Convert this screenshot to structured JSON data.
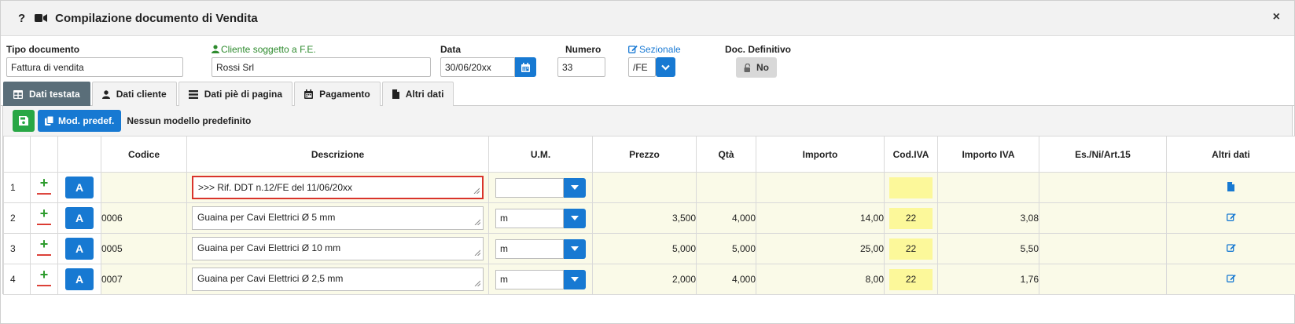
{
  "window": {
    "title": "Compilazione documento di Vendita",
    "help": "?",
    "close": "×"
  },
  "fields": {
    "tipo_label": "Tipo documento",
    "tipo_value": "Fattura di vendita",
    "cliente_label": "Cliente soggetto a F.E.",
    "cliente_value": "Rossi Srl",
    "data_label": "Data",
    "data_value": "30/06/20xx",
    "numero_label": "Numero",
    "numero_value": "33",
    "sezionale_label": "Sezionale",
    "sezionale_value": "/FE",
    "definitivo_label": "Doc. Definitivo",
    "definitivo_value": "No"
  },
  "tabs": [
    {
      "label": "Dati testata",
      "icon": "table-icon",
      "active": true
    },
    {
      "label": "Dati cliente",
      "icon": "user-icon"
    },
    {
      "label": "Dati piè di pagina",
      "icon": "list-icon"
    },
    {
      "label": "Pagamento",
      "icon": "calendar-icon"
    },
    {
      "label": "Altri dati",
      "icon": "file-icon"
    }
  ],
  "toolbar": {
    "mod_label": "Mod. predef.",
    "no_model_text": "Nessun modello predefinito"
  },
  "table": {
    "headers": [
      "Codice",
      "Descrizione",
      "U.M.",
      "Prezzo",
      "Qtà",
      "Importo",
      "Cod.IVA",
      "Importo IVA",
      "Es./Ni/Art.15",
      "Altri dati"
    ],
    "rows": [
      {
        "n": "1",
        "a": "A",
        "codice": "",
        "descrizione": ">>> Rif. DDT n.12/FE del 11/06/20xx",
        "um": "",
        "prezzo": "",
        "qta": "",
        "importo": "",
        "iva": "",
        "importo_iva": "",
        "es": ""
      },
      {
        "n": "2",
        "a": "A",
        "codice": "0006",
        "descrizione": "Guaina per Cavi Elettrici Ø 5 mm",
        "um": "m",
        "prezzo": "3,500",
        "qta": "4,000",
        "importo": "14,00",
        "iva": "22",
        "importo_iva": "3,08",
        "es": ""
      },
      {
        "n": "3",
        "a": "A",
        "codice": "0005",
        "descrizione": "Guaina per Cavi Elettrici Ø 10 mm",
        "um": "m",
        "prezzo": "5,000",
        "qta": "5,000",
        "importo": "25,00",
        "iva": "22",
        "importo_iva": "5,50",
        "es": ""
      },
      {
        "n": "4",
        "a": "A",
        "codice": "0007",
        "descrizione": "Guaina per Cavi Elettrici Ø 2,5 mm",
        "um": "m",
        "prezzo": "2,000",
        "qta": "4,000",
        "importo": "8,00",
        "iva": "22",
        "importo_iva": "1,76",
        "es": ""
      }
    ]
  },
  "colors": {
    "accent": "#1779d2",
    "green": "#28a745",
    "active_tab": "#5a6e79",
    "highlight": "#d9342b",
    "iva_bg": "#fcf89a"
  }
}
